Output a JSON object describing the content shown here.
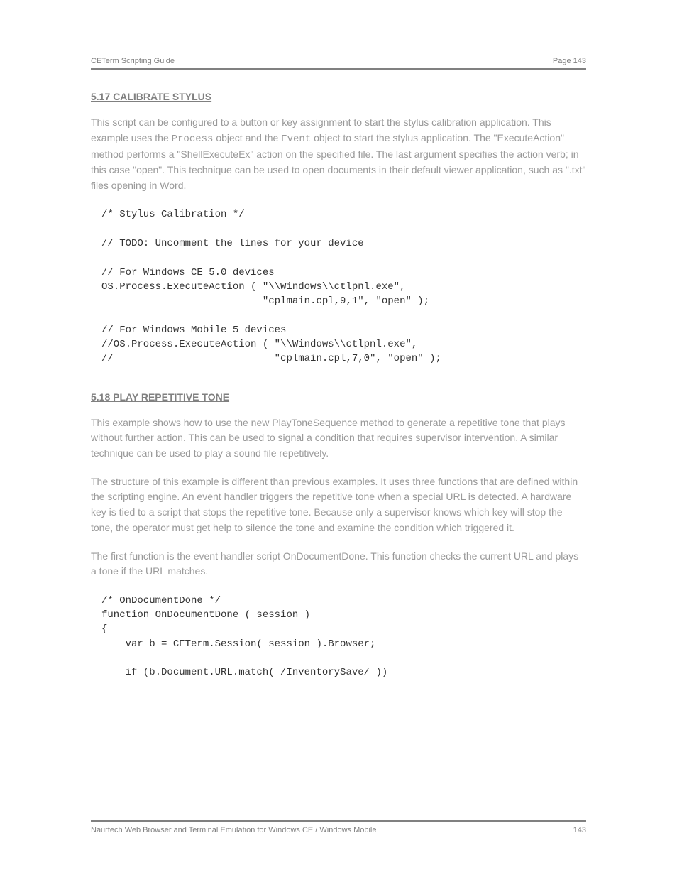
{
  "header": {
    "left": "CETerm Scripting Guide",
    "right": "Page 143"
  },
  "section1": {
    "heading": "5.17 CALIBRATE STYLUS",
    "para1_a": "This script can be configured to a button or key assignment to start the stylus calibration application. This example uses the ",
    "para1_code": "Process",
    "para1_b": " object and the ",
    "para1_code2": "Event",
    "para1_c": " object to start the stylus application. The \"ExecuteAction\" method performs a \"ShellExecuteEx\" action on the specified file. The last argument specifies the action verb; in this case \"open\". This technique can be used to open documents in their default viewer application, such as \".txt\" files opening in Word.",
    "code": "/* Stylus Calibration */\n\n// TODO: Uncomment the lines for your device\n\n// For Windows CE 5.0 devices\nOS.Process.ExecuteAction ( \"\\\\Windows\\\\ctlpnl.exe\",\n                           \"cplmain.cpl,9,1\", \"open\" );\n\n// For Windows Mobile 5 devices\n//OS.Process.ExecuteAction ( \"\\\\Windows\\\\ctlpnl.exe\",\n//                           \"cplmain.cpl,7,0\", \"open\" );"
  },
  "section2": {
    "heading": "5.18 PLAY REPETITIVE TONE",
    "para1": "This example shows how to use the new PlayToneSequence method to generate a repetitive tone that plays without further action. This can be used to signal a condition that requires supervisor intervention. A similar technique can be used to play a sound file repetitively.",
    "para2": "The structure of this example is different than previous examples. It uses three functions that are defined within the scripting engine. An event handler triggers the repetitive tone when a special URL is detected. A hardware key is tied to a script that stops the repetitive tone. Because only a supervisor knows which key will stop the tone, the operator must get help to silence the tone and examine the condition which triggered it.",
    "para3": "The first function is the event handler script OnDocumentDone. This function checks the current URL and plays a tone if the URL matches.",
    "code": "/* OnDocumentDone */\nfunction OnDocumentDone ( session )\n{\n    var b = CETerm.Session( session ).Browser;\n\n    if (b.Document.URL.match( /InventorySave/ ))"
  },
  "footer": {
    "left": "Naurtech Web Browser and Terminal Emulation for Windows CE / Windows Mobile",
    "right": "143"
  }
}
